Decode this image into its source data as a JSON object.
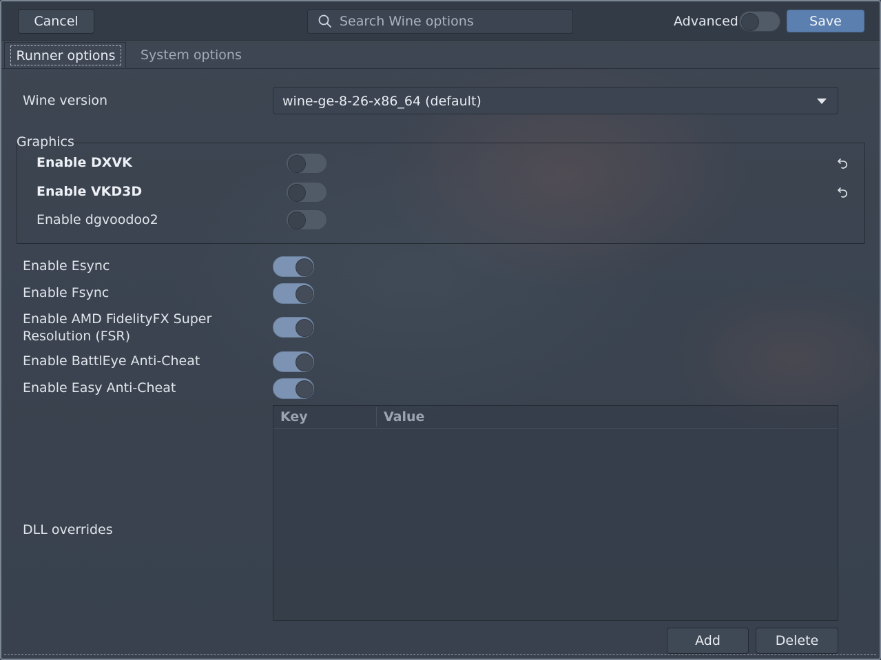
{
  "header": {
    "cancel_label": "Cancel",
    "search_placeholder": "Search Wine options",
    "advanced_label": "Advanced",
    "advanced_on": false,
    "save_label": "Save"
  },
  "tabs": [
    {
      "label": "Runner options",
      "active": true
    },
    {
      "label": "System options",
      "active": false
    }
  ],
  "wine_version": {
    "label": "Wine version",
    "value": "wine-ge-8-26-x86_64 (default)"
  },
  "graphics": {
    "title": "Graphics",
    "items": [
      {
        "label": "Enable DXVK",
        "on": false,
        "bold": true,
        "resettable": true
      },
      {
        "label": "Enable VKD3D",
        "on": false,
        "bold": true,
        "resettable": true
      },
      {
        "label": "Enable dgvoodoo2",
        "on": false,
        "bold": false,
        "resettable": false
      }
    ]
  },
  "options": [
    {
      "label": "Enable Esync",
      "on": true
    },
    {
      "label": "Enable Fsync",
      "on": true
    },
    {
      "label_line1": "Enable AMD FidelityFX Super",
      "label_line2": "Resolution (FSR)",
      "on": true
    },
    {
      "label": "Enable BattlEye Anti-Cheat",
      "on": true
    },
    {
      "label": "Enable Easy Anti-Cheat",
      "on": true
    }
  ],
  "dll_overrides": {
    "label": "DLL overrides",
    "columns": [
      "Key",
      "Value"
    ],
    "rows": [],
    "add_label": "Add",
    "delete_label": "Delete"
  },
  "colors": {
    "accent": "#5b7fae",
    "switch_on": "#7d93b3",
    "background": "#3b4450"
  }
}
